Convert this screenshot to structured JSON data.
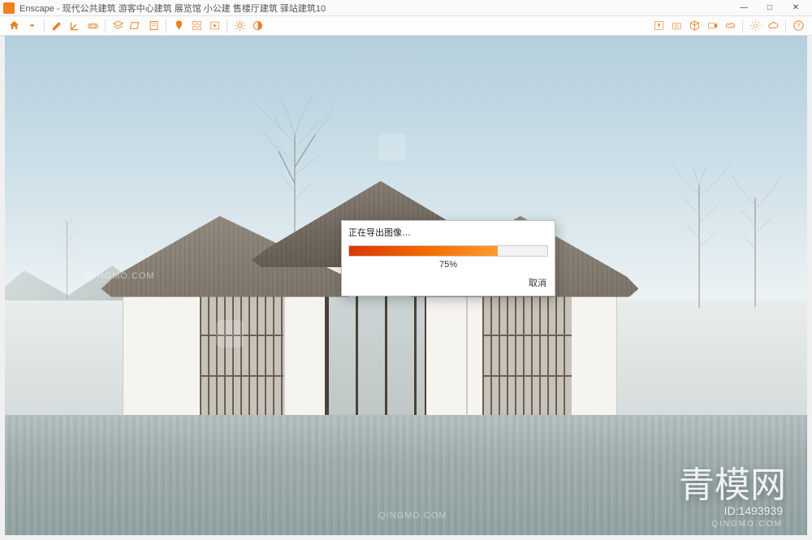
{
  "window": {
    "app_name": "Enscape",
    "title_sep": " - ",
    "document_title": "现代公共建筑 游客中心建筑 展览馆 小公建 售楼厅建筑 驿站建筑10",
    "controls": {
      "minimize": "—",
      "maximize": "□",
      "close": "✕"
    }
  },
  "toolbar": {
    "icons": {
      "home": "home-icon",
      "pencil": "pencil-icon",
      "axis": "axis-icon",
      "goggle": "goggles-icon",
      "layer": "layer-icon",
      "plane": "plane-icon",
      "notes": "notes-icon",
      "pin": "pin-icon",
      "grid": "grid-icon",
      "play": "play-icon",
      "sun": "sun-icon",
      "mono": "monochrome-icon"
    },
    "right_icons": {
      "export": "export-icon",
      "camera": "camera-icon",
      "cube": "cube-icon",
      "film": "film-icon",
      "link": "link-icon",
      "gear": "settings-icon",
      "cloud": "cloud-icon",
      "help": "help-icon"
    }
  },
  "dialog": {
    "title": "正在导出图像…",
    "progress_percent": 75,
    "progress_text": "75%",
    "cancel_label": "取消"
  },
  "watermarks": {
    "qingmo": "QINGMO.COM",
    "brand": "青模网",
    "id_label": "ID:1493939",
    "brand_sub": "QINGMO.COM"
  },
  "colors": {
    "accent": "#f08020",
    "progress_start": "#d93800",
    "progress_end": "#ff9a2e"
  }
}
